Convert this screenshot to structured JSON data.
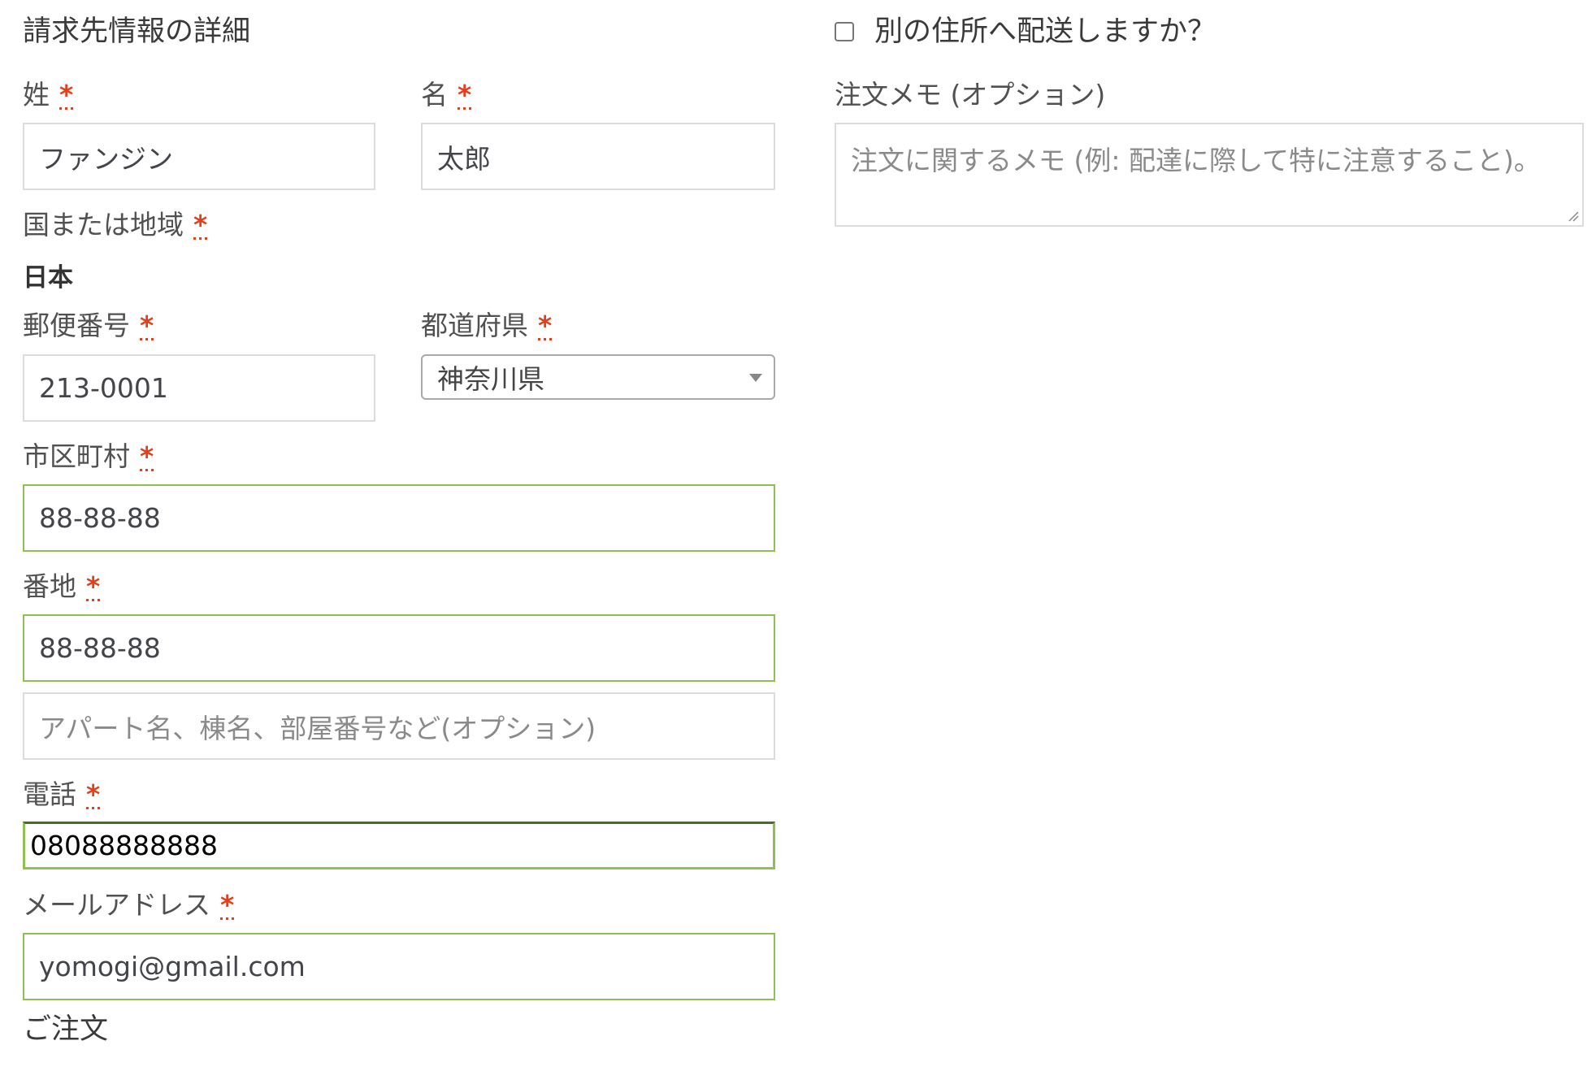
{
  "billing": {
    "title": "請求先情報の詳細",
    "required_mark": "*",
    "last_name": {
      "label": "姓",
      "value": "ファンジン"
    },
    "first_name": {
      "label": "名",
      "value": "太郎"
    },
    "country": {
      "label": "国または地域",
      "value": "日本"
    },
    "postcode": {
      "label": "郵便番号",
      "value": "213-0001"
    },
    "state": {
      "label": "都道府県",
      "value": "神奈川県"
    },
    "city": {
      "label": "市区町村",
      "value": "88-88-88"
    },
    "address1": {
      "label": "番地",
      "value": "88-88-88"
    },
    "address2": {
      "placeholder": "アパート名、棟名、部屋番号など(オプション)"
    },
    "phone": {
      "label": "電話",
      "value": "08088888888"
    },
    "email": {
      "label": "メールアドレス",
      "value": "yomogi@gmail.com"
    }
  },
  "shipping": {
    "ship_different_label": "別の住所へ配送しますか？",
    "order_notes": {
      "label": "注文メモ (オプション)",
      "placeholder": "注文に関するメモ (例: 配達に際して特に注意すること)。"
    }
  },
  "order": {
    "title": "ご注文"
  },
  "colors": {
    "required": "#e2401c",
    "valid_border": "#8dc153",
    "default_border": "#dcdcdc"
  }
}
